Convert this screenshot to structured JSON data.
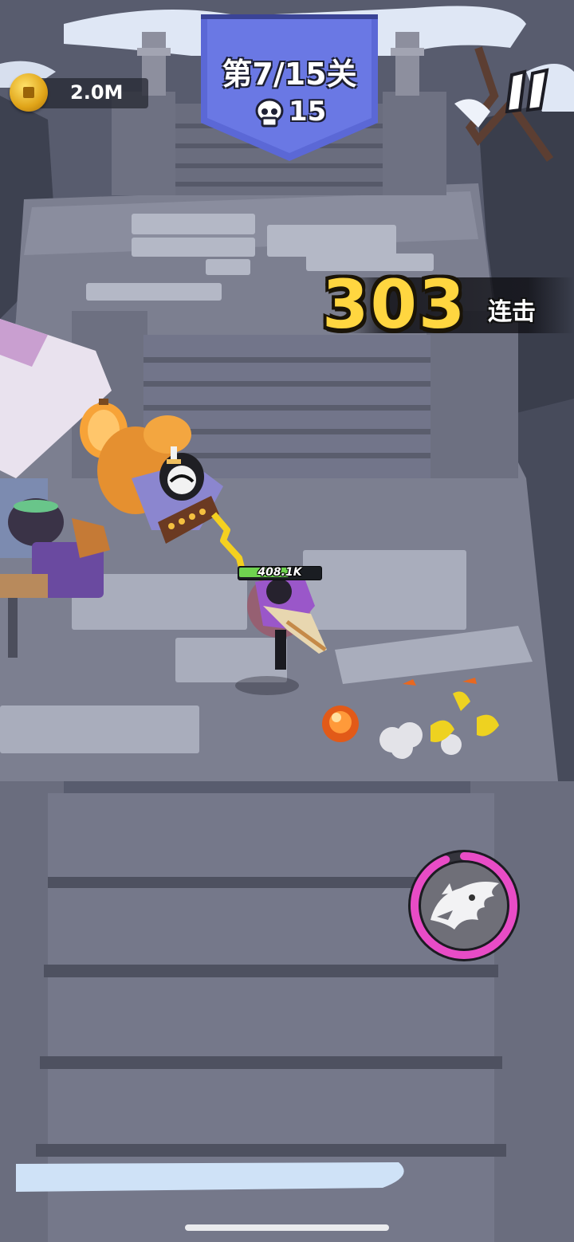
{
  "hud": {
    "coins": "2.0M",
    "level": "第7/15关",
    "kills": "15",
    "combo_count": "303",
    "combo_label": "连击",
    "player_hp": "408.1K",
    "player_hp_fraction": 0.62
  },
  "skill": {
    "icon": "dragon-icon",
    "cooldown_fraction": 0.94,
    "ring_color": "#e84cc6"
  },
  "colors": {
    "banner": "#5b68d6",
    "combo_number": "#ffd640",
    "hp_fill": "#6fd24f"
  }
}
